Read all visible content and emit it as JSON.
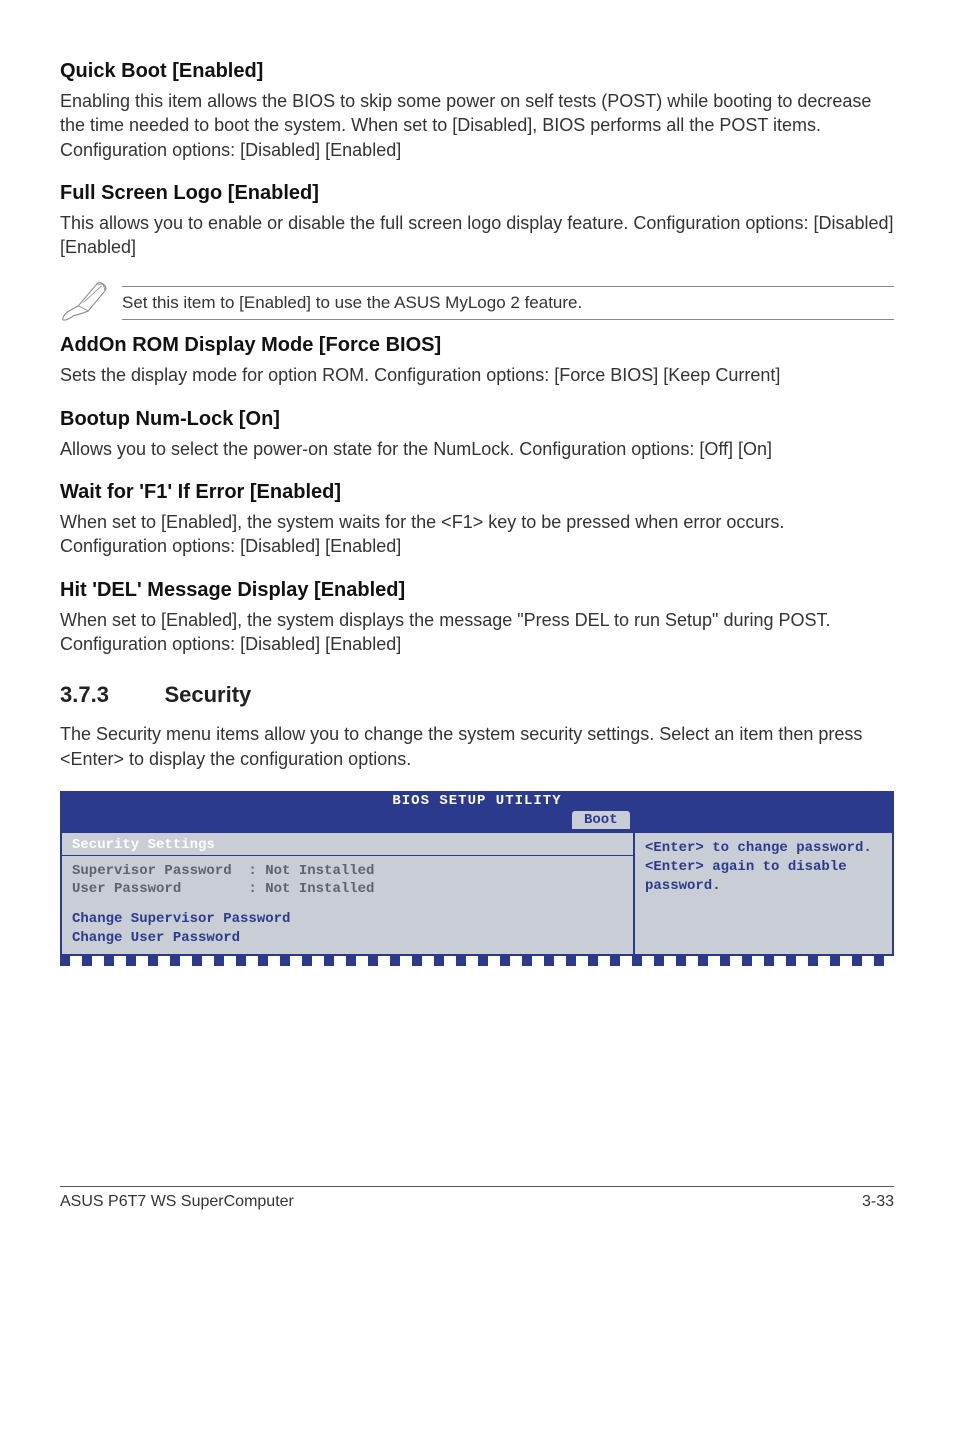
{
  "s1": {
    "h": "Quick Boot [Enabled]",
    "p": "Enabling this item allows the BIOS to skip some power on self tests (POST) while booting to decrease the time needed to boot the system. When set to [Disabled], BIOS performs all the POST items. Configuration options: [Disabled] [Enabled]"
  },
  "s2": {
    "h": "Full Screen Logo [Enabled]",
    "p": "This allows you to enable or disable the full screen logo display feature. Configuration options: [Disabled] [Enabled]"
  },
  "note": {
    "text": "Set this item to [Enabled] to use the ASUS MyLogo 2 feature."
  },
  "s3": {
    "h": "AddOn ROM Display Mode [Force BIOS]",
    "p": "Sets the display mode for option ROM. Configuration options: [Force BIOS] [Keep Current]"
  },
  "s4": {
    "h": "Bootup Num-Lock [On]",
    "p": "Allows you to select the power-on state for the NumLock. Configuration options: [Off] [On]"
  },
  "s5": {
    "h": "Wait for 'F1' If Error [Enabled]",
    "p": "When set to [Enabled], the system waits for the <F1> key to be pressed when error occurs. Configuration options: [Disabled] [Enabled]"
  },
  "s6": {
    "h": "Hit 'DEL' Message Display [Enabled]",
    "p": "When set to [Enabled], the system displays the message \"Press DEL to run Setup\" during POST. Configuration options: [Disabled] [Enabled]"
  },
  "section": {
    "number": "3.7.3",
    "title": "Security",
    "intro": "The Security menu items allow you to change the system security settings. Select an item then press <Enter> to display the configuration options."
  },
  "bios": {
    "header": "BIOS SETUP UTILITY",
    "tab": "Boot",
    "section_title": "Security Settings",
    "line_sup": "Supervisor Password  : Not Installed",
    "line_usr": "User Password        : Not Installed",
    "link_sup": "Change Supervisor Password",
    "link_usr": "Change User Password",
    "help": "<Enter> to change password. <Enter> again to disable password."
  },
  "footer": {
    "left": "ASUS P6T7 WS SuperComputer",
    "right": "3-33"
  }
}
